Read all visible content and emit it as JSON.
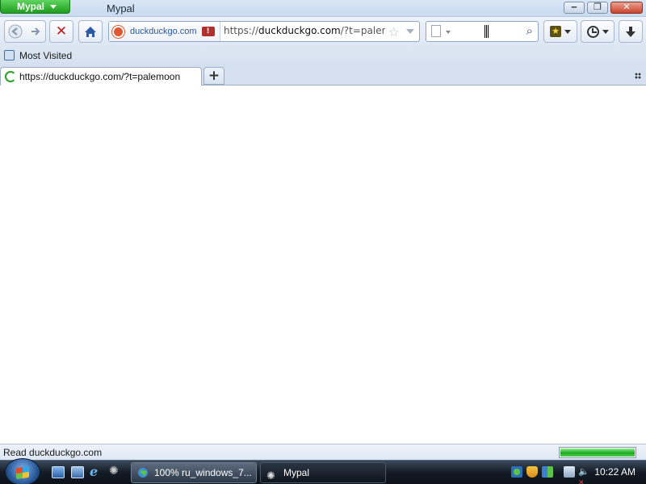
{
  "window": {
    "app_menu_label": "Mypal",
    "title": "Mypal",
    "minimize_glyph": "‒",
    "maximize_glyph": "❐",
    "close_glyph": "✕"
  },
  "navbar": {
    "back_icon": "back-arrow-icon",
    "forward_icon": "forward-arrow-icon",
    "stop_glyph": "✕",
    "home_glyph": "⌂",
    "identity_domain": "duckduckgo.com",
    "url_prefix": "https://",
    "url_domain": "duckduckgo.com",
    "url_suffix": "/?t=palemoo",
    "search_value": "",
    "download_glyph": "🡇"
  },
  "bookmarks_bar": {
    "items": [
      {
        "label": "Most Visited"
      }
    ]
  },
  "tabs": [
    {
      "label": "https://duckduckgo.com/?t=palemoon",
      "loading": true
    }
  ],
  "new_tab_glyph": "+",
  "statusbar": {
    "text": "Read duckduckgo.com",
    "progress": 1.0
  },
  "taskbar": {
    "buttons": [
      {
        "label": "100% ru_windows_7...",
        "active": false
      },
      {
        "label": "Mypal",
        "active": true
      }
    ],
    "clock": "10:22 AM"
  }
}
